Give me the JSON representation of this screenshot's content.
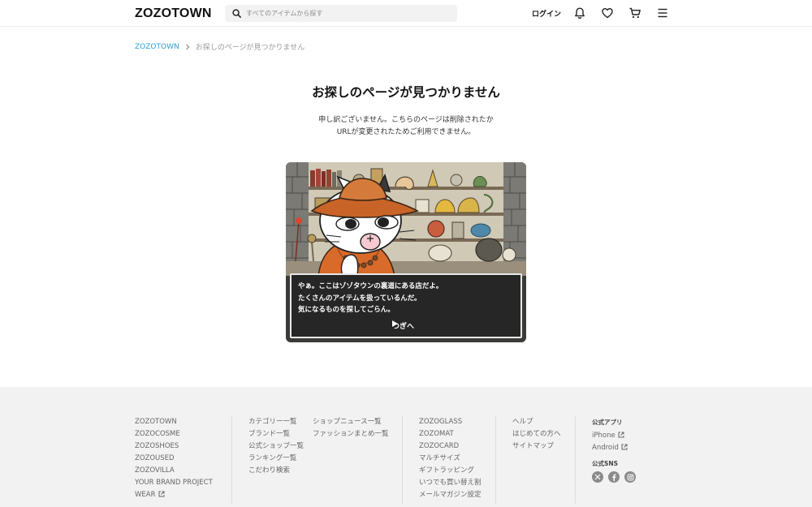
{
  "header": {
    "logo": "ZOZOTOWN",
    "search_placeholder": "すべてのアイテムから探す",
    "login_label": "ログイン"
  },
  "breadcrumb": {
    "home": "ZOZOTOWN",
    "current": "お探しのページが見つかりません"
  },
  "main": {
    "title": "お探しのページが見つかりません",
    "message_line1": "申し訳ございません。こちらのページは削除されたか",
    "message_line2": "URLが変更されたためご利用できません。",
    "dialog": {
      "line1": "やぁ。ここはゾゾタウンの裏道にある店だよ。",
      "line2": "たくさんのアイテムを扱っているんだ。",
      "line3": "気になるものを探してごらん。",
      "next_label": "つぎへ"
    }
  },
  "footer": {
    "col1": [
      "ZOZOTOWN",
      "ZOZOCOSME",
      "ZOZOSHOES",
      "ZOZOUSED",
      "ZOZOVILLA",
      "YOUR BRAND PROJECT",
      "WEAR"
    ],
    "col2a": [
      "カテゴリー一覧",
      "ブランド一覧",
      "公式ショップ一覧",
      "ランキング一覧",
      "こだわり検索"
    ],
    "col2b": [
      "ショップニュース一覧",
      "ファッションまとめ一覧"
    ],
    "col3": [
      "ZOZOGLASS",
      "ZOZOMAT",
      "ZOZOCARD",
      "マルチサイズ",
      "ギフトラッピング",
      "いつでも買い替え割",
      "メールマガジン設定"
    ],
    "col4": [
      "ヘルプ",
      "はじめての方へ",
      "サイトマップ"
    ],
    "apps_heading": "公式アプリ",
    "app_iphone": "iPhone",
    "app_android": "Android",
    "sns_heading": "公式SNS"
  },
  "colors": {
    "accent_link": "#2a9fd0",
    "footer_bg": "#f2f2f2"
  }
}
